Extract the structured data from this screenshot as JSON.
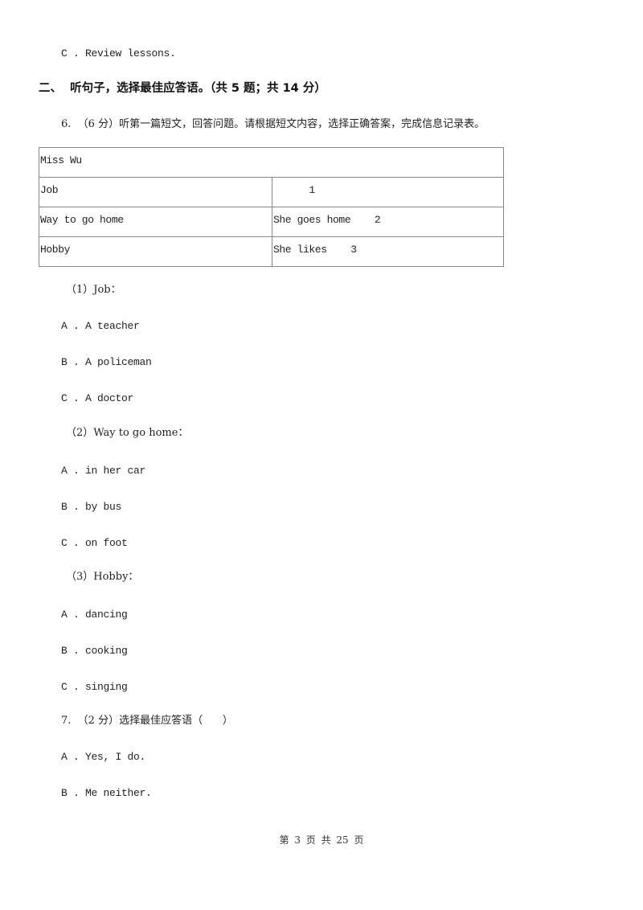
{
  "prev_question": {
    "option_c": "C . Review lessons."
  },
  "section": {
    "heading": "二、  听句子，选择最佳应答语。（共 5 题；共 14 分）"
  },
  "q6": {
    "stem": "6.  （6 分）听第一篇短文，回答问题。请根据短文内容，选择正确答案，完成信息记录表。",
    "table": {
      "title": "Miss Wu",
      "rows": [
        {
          "label": "Job",
          "value": "      1"
        },
        {
          "label": "Way to go home",
          "value": "She goes home    2"
        },
        {
          "label": "Hobby",
          "value": "She likes    3"
        }
      ]
    },
    "sub1": {
      "prompt": "（1）Job：",
      "options": [
        "A . A teacher",
        "B . A policeman",
        "C . A doctor"
      ]
    },
    "sub2": {
      "prompt": "（2）Way to go home：",
      "options": [
        "A . in her car",
        "B . by bus",
        "C . on foot"
      ]
    },
    "sub3": {
      "prompt": "（3）Hobby：",
      "options": [
        "A . dancing",
        "B . cooking",
        "C . singing"
      ]
    }
  },
  "q7": {
    "stem": "7.  （2 分）选择最佳应答语（      ）",
    "options": [
      "A . Yes, I do.",
      "B . Me neither."
    ]
  },
  "footer": {
    "page_text": "第 3 页 共 25 页"
  }
}
